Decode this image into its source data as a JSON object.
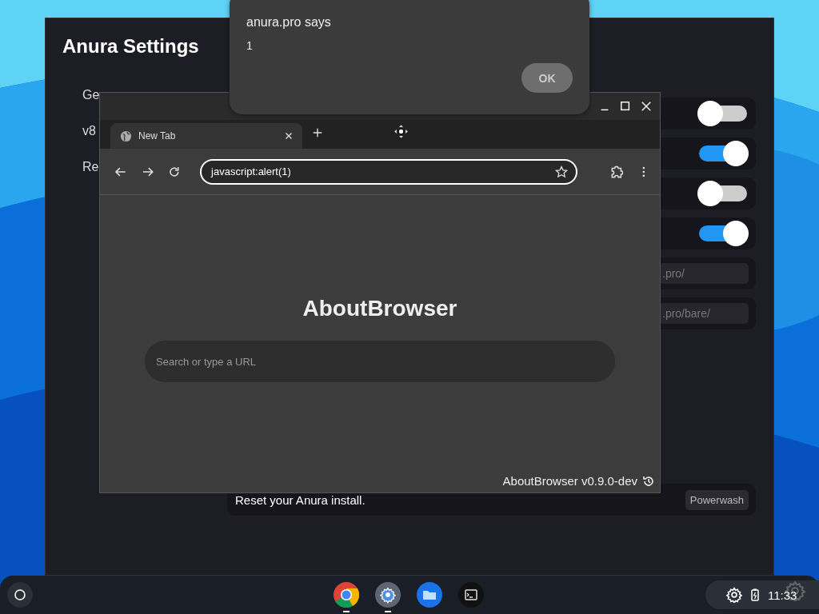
{
  "settings_window": {
    "title": "Anura Settings",
    "nav_items": [
      "Ge",
      "v8",
      "Re"
    ],
    "rows": [
      {
        "kind": "toggle",
        "on": false
      },
      {
        "kind": "toggle",
        "on": true
      },
      {
        "kind": "toggle",
        "on": false
      },
      {
        "kind": "toggle",
        "on": true
      },
      {
        "kind": "text",
        "value": ".pro/"
      },
      {
        "kind": "text",
        "value": ".pro/bare/"
      }
    ],
    "reset": {
      "text": "Reset your Anura install.",
      "button": "Powerwash"
    }
  },
  "browser": {
    "tabs": [
      {
        "label": "New Tab"
      }
    ],
    "address": "javascript:alert(1)",
    "page_title": "AboutBrowser",
    "search_placeholder": "Search or type a URL",
    "version": "AboutBrowser v0.9.0-dev"
  },
  "dialog": {
    "title": "anura.pro says",
    "message": "1",
    "button": "OK"
  },
  "taskbar": {
    "apps": [
      {
        "kind": "browser",
        "running": true
      },
      {
        "kind": "settings",
        "running": true
      },
      {
        "kind": "files",
        "running": false
      },
      {
        "kind": "terminal",
        "running": false
      }
    ],
    "clock": "11:33"
  }
}
